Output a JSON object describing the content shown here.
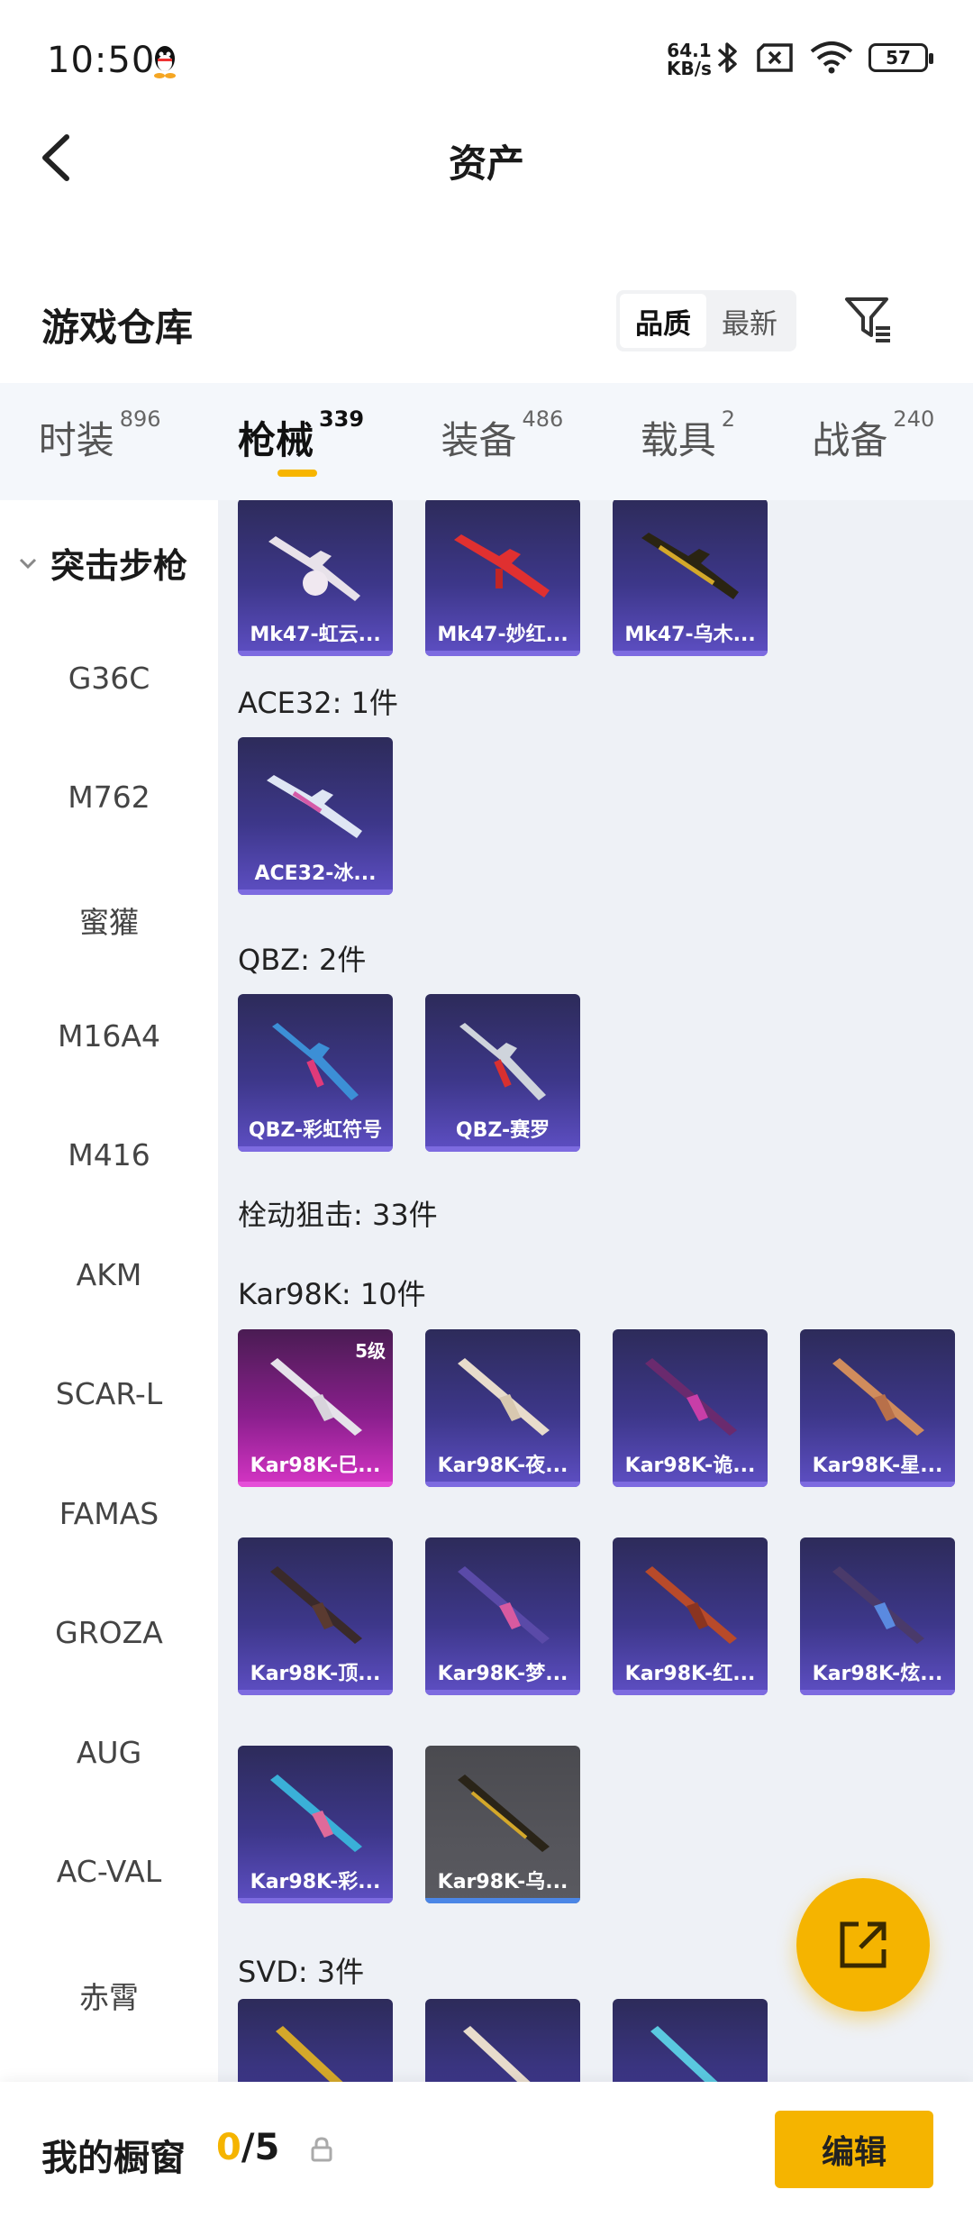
{
  "status_bar": {
    "time": "10:50",
    "net_speed_value": "64.1",
    "net_speed_unit": "KB/s",
    "battery": "57"
  },
  "header": {
    "title": "资产"
  },
  "section": {
    "title": "游戏仓库",
    "sort_options": [
      "品质",
      "最新"
    ],
    "active_sort": "品质"
  },
  "tabs": [
    {
      "label": "时装",
      "count": "896"
    },
    {
      "label": "枪械",
      "count": "339",
      "active": true
    },
    {
      "label": "装备",
      "count": "486"
    },
    {
      "label": "载具",
      "count": "2"
    },
    {
      "label": "战备",
      "count": "240"
    }
  ],
  "sidebar": {
    "group": "突击步枪",
    "items": [
      "G36C",
      "M762",
      "蜜獾",
      "M16A4",
      "M416",
      "AKM",
      "SCAR-L",
      "FAMAS",
      "GROZA",
      "AUG",
      "AC-VAL",
      "赤霄"
    ]
  },
  "content": {
    "mk47_items": [
      "Mk47-虹云...",
      "Mk47-妙红...",
      "Mk47-乌木..."
    ],
    "ace32": {
      "title": "ACE32: 1件",
      "items": [
        "ACE32-冰..."
      ]
    },
    "qbz": {
      "title": "QBZ: 2件",
      "items": [
        "QBZ-彩虹符号",
        "QBZ-赛罗"
      ]
    },
    "bolt_title": "栓动狙击: 33件",
    "kar98k": {
      "title": "Kar98K: 10件",
      "level_badge": "5级",
      "items": [
        "Kar98K-巳...",
        "Kar98K-夜...",
        "Kar98K-诡...",
        "Kar98K-星...",
        "Kar98K-顶...",
        "Kar98K-梦...",
        "Kar98K-红...",
        "Kar98K-炫...",
        "Kar98K-彩...",
        "Kar98K-乌..."
      ]
    },
    "svd": {
      "title": "SVD: 3件"
    }
  },
  "bottom_bar": {
    "label": "我的橱窗",
    "current": "0",
    "total": "/5",
    "edit_label": "编辑"
  },
  "colors": {
    "accent": "#f5b400",
    "card_purple": "#3d378a",
    "card_pink": "#8a1f8d",
    "card_gray": "#55555b"
  }
}
